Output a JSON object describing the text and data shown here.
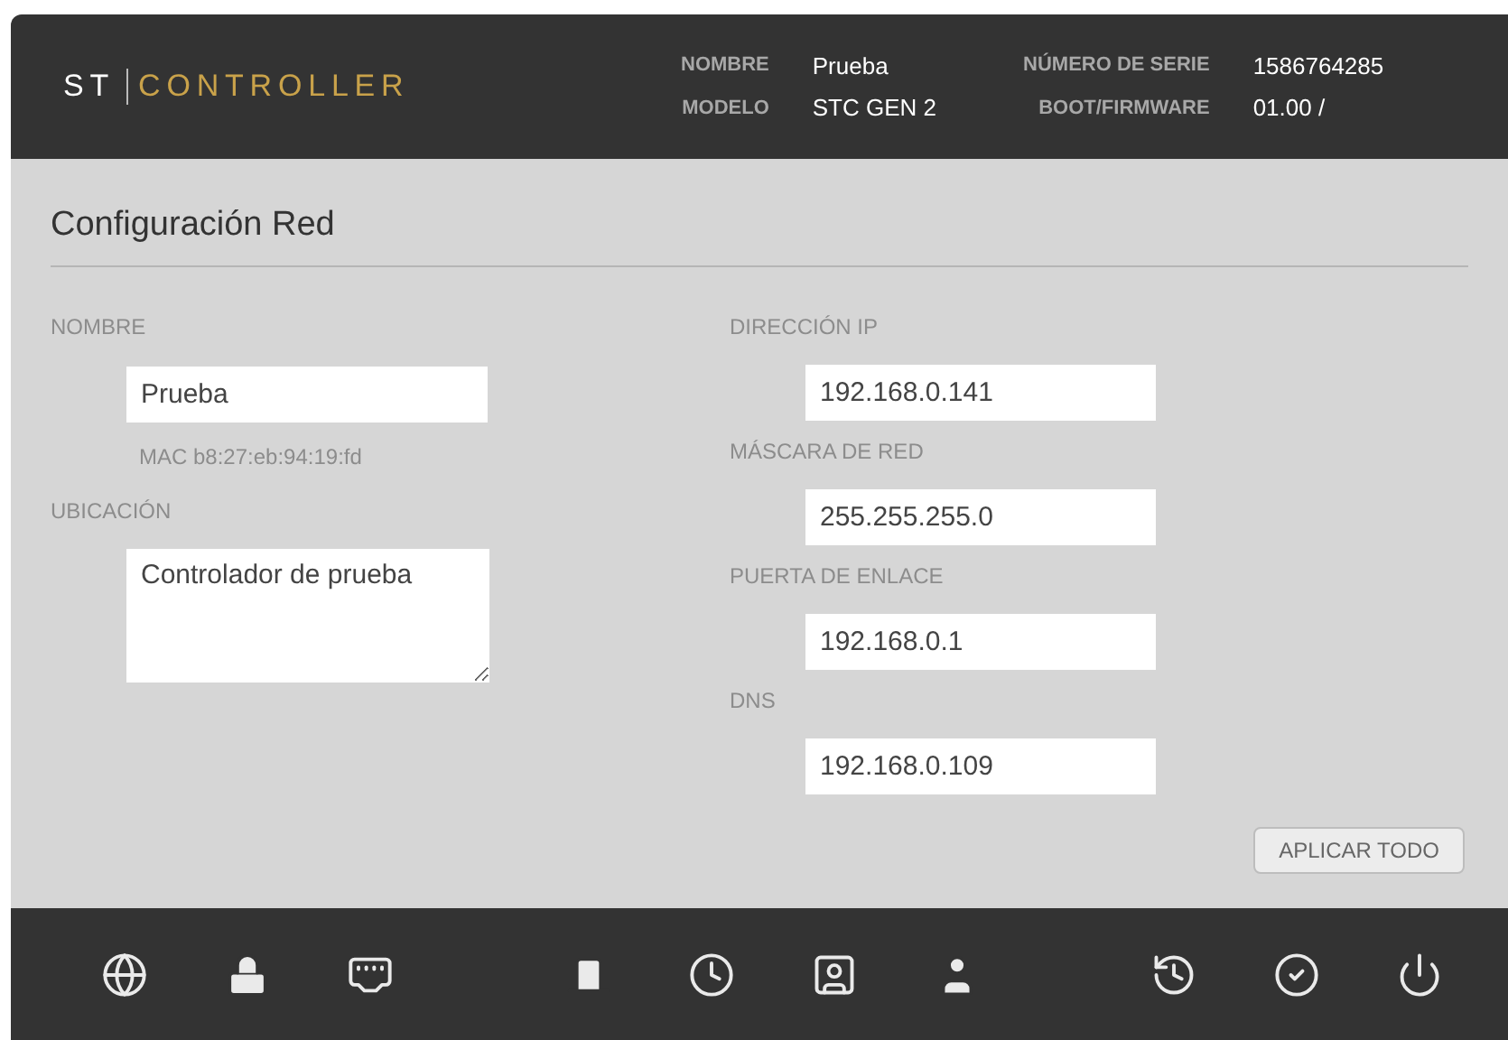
{
  "header": {
    "logo_left": "ST",
    "logo_right": "CONTROLLER",
    "info": [
      {
        "label": "NOMBRE",
        "value": "Prueba"
      },
      {
        "label": "MODELO",
        "value": "STC GEN 2"
      },
      {
        "label": "NÚMERO DE SERIE",
        "value": "1586764285"
      },
      {
        "label": "BOOT/FIRMWARE",
        "value": "01.00 /"
      }
    ]
  },
  "section_title": "Configuración Red",
  "left": {
    "name_label": "NOMBRE",
    "name_value": "Prueba",
    "mac": "MAC b8:27:eb:94:19:fd",
    "location_label": "UBICACIÓN",
    "location_value": "Controlador de prueba"
  },
  "right": [
    {
      "label": "DIRECCIÓN IP",
      "value": "192.168.0.141"
    },
    {
      "label": "MÁSCARA DE RED",
      "value": "255.255.255.0"
    },
    {
      "label": "PUERTA DE ENLACE",
      "value": "192.168.0.1"
    },
    {
      "label": "DNS",
      "value": "192.168.0.109"
    }
  ],
  "apply_button": "APLICAR TODO"
}
